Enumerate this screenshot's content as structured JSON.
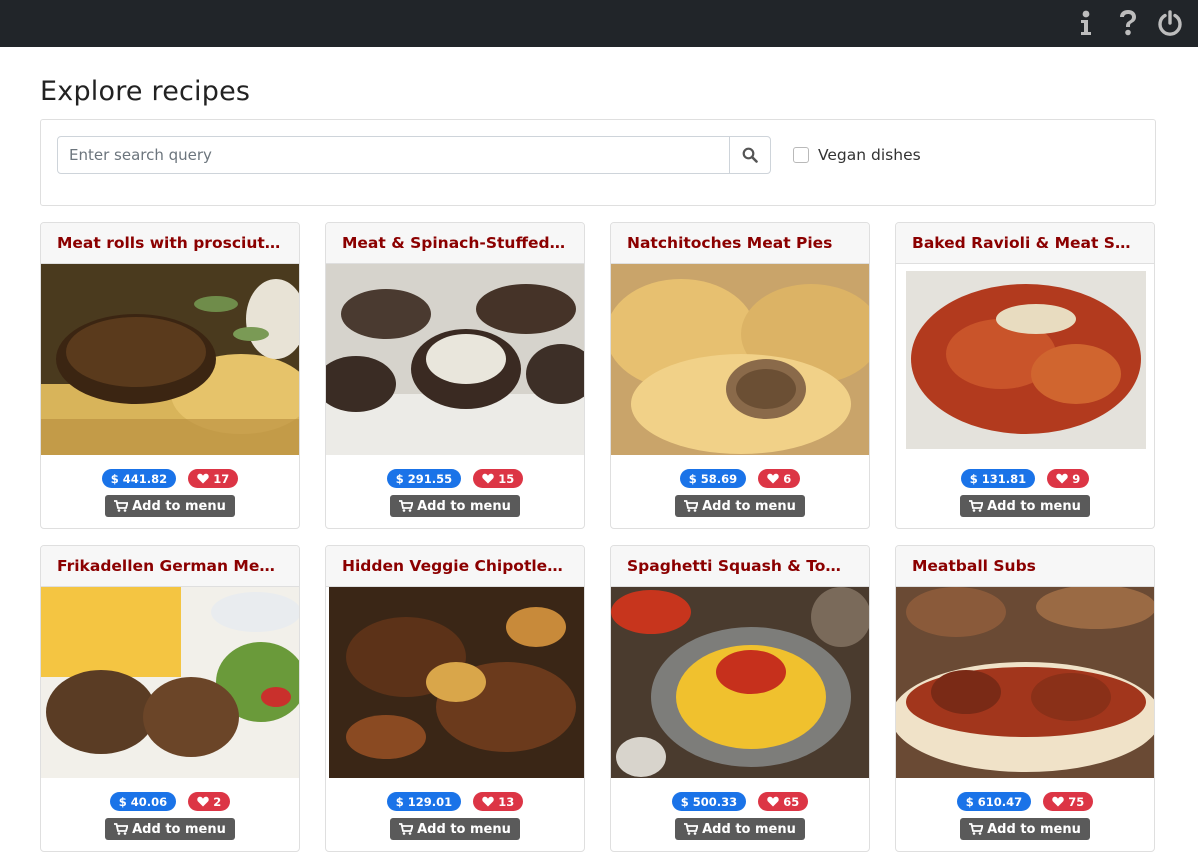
{
  "header": {
    "icons": [
      "info-icon",
      "help-icon",
      "power-icon"
    ]
  },
  "page": {
    "title": "Explore recipes"
  },
  "search": {
    "placeholder": "Enter search query",
    "value": "",
    "vegan_label": "Vegan dishes",
    "vegan_checked": false
  },
  "colors": {
    "title": "#8b0000",
    "price_badge": "#1a73e8",
    "likes_badge": "#dc3545",
    "topbar": "#212529",
    "button": "#5a5a5a"
  },
  "add_label": "Add to menu",
  "recipes": [
    {
      "title": "Meat rolls with prosciutto and sage",
      "price": "441.82",
      "likes": "17"
    },
    {
      "title": "Meat & Spinach-Stuffed Portobello",
      "price": "291.55",
      "likes": "15"
    },
    {
      "title": "Natchitoches Meat Pies",
      "price": "58.69",
      "likes": "6"
    },
    {
      "title": "Baked Ravioli & Meat Sauce",
      "price": "131.81",
      "likes": "9"
    },
    {
      "title": "Frikadellen German Meat Patties",
      "price": "40.06",
      "likes": "2"
    },
    {
      "title": "Hidden Veggie Chipotle Tacos",
      "price": "129.01",
      "likes": "13"
    },
    {
      "title": "Spaghetti Squash & Tomato Sauce",
      "price": "500.33",
      "likes": "65"
    },
    {
      "title": "Meatball Subs",
      "price": "610.47",
      "likes": "75"
    }
  ]
}
